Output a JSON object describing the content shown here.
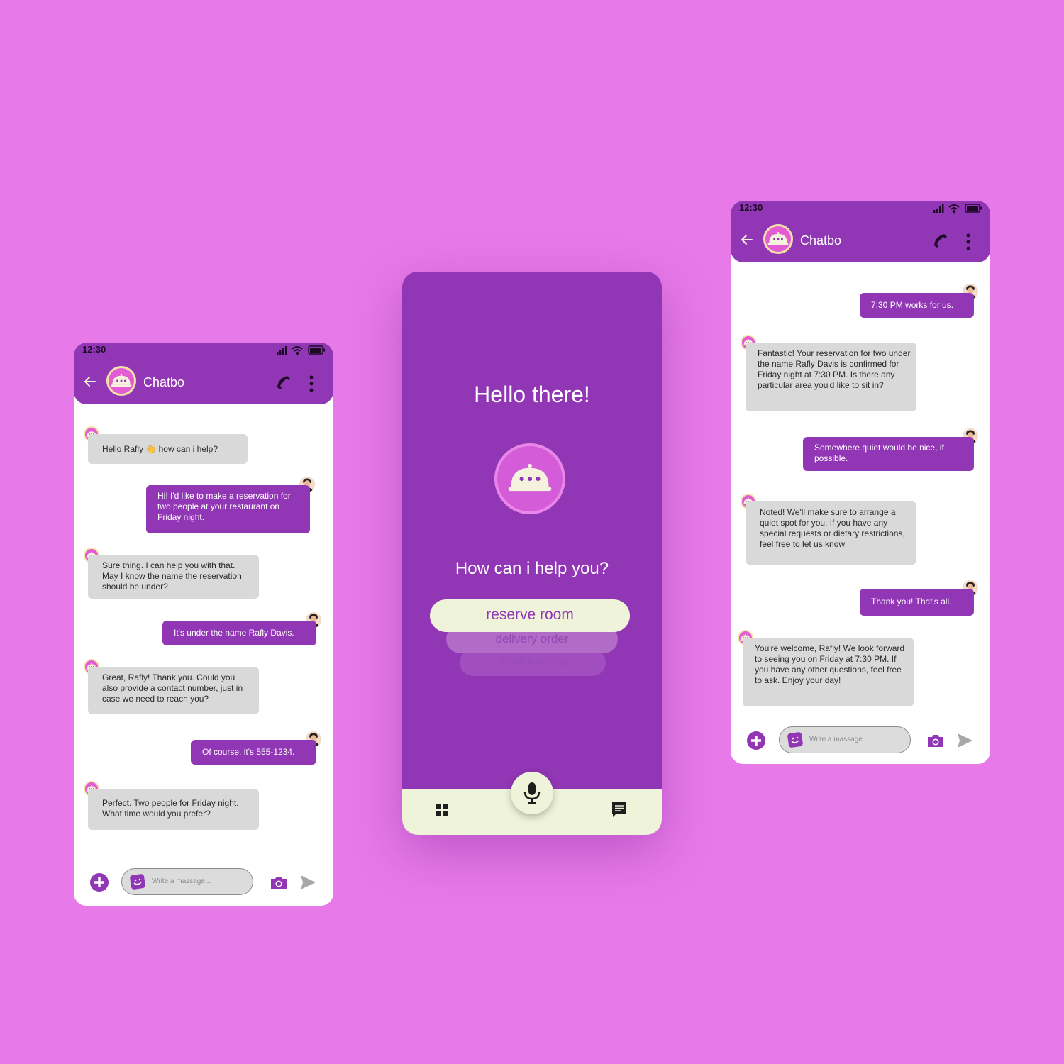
{
  "colors": {
    "background": "#e77ae8",
    "primary": "#9136b4",
    "bubble_bot": "#d9d9d9",
    "cream": "#eef3da",
    "bot_avatar": "#e45cd4"
  },
  "left_phone": {
    "status_time": "12:30",
    "title": "Chatbo",
    "messages": [
      {
        "from": "bot",
        "text": "Hello Rafly 👋 how can i help?"
      },
      {
        "from": "user",
        "text": "Hi! I'd like to make a reservation for two people at your restaurant on Friday night."
      },
      {
        "from": "bot",
        "text": "Sure thing. I can help you with that. May I know the name the reservation should be under?"
      },
      {
        "from": "user",
        "text": "It's under the name Rafly Davis."
      },
      {
        "from": "bot",
        "text": "Great, Rafly! Thank you. Could you also provide a contact number, just in case we need to reach you?"
      },
      {
        "from": "user",
        "text": "Of course, it's 555-1234."
      },
      {
        "from": "bot",
        "text": "Perfect. Two people for Friday night. What time would you prefer?"
      }
    ],
    "input_placeholder": "Write a massage..."
  },
  "center_phone": {
    "greeting": "Hello there!",
    "question": "How can i help you?",
    "options": [
      "reserve room",
      "delivery order",
      "order tracking"
    ]
  },
  "right_phone": {
    "status_time": "12:30",
    "title": "Chatbo",
    "messages": [
      {
        "from": "user",
        "text": "7:30 PM works for us."
      },
      {
        "from": "bot",
        "text": "Fantastic! Your reservation for two under the name Rafly Davis is confirmed for Friday night at 7:30 PM. Is there any particular area you'd like to sit in?"
      },
      {
        "from": "user",
        "text": "Somewhere quiet would be nice, if possible."
      },
      {
        "from": "bot",
        "text": "Noted! We'll make sure to arrange a quiet spot for you. If you have any special requests or dietary restrictions, feel free to let us know"
      },
      {
        "from": "user",
        "text": "Thank you! That's all."
      },
      {
        "from": "bot",
        "text": "You're welcome, Rafly! We look forward to seeing you on Friday at 7:30 PM. If you have any other questions, feel free to ask. Enjoy your day!"
      }
    ],
    "input_placeholder": "Write a massage..."
  },
  "icons": [
    "back-arrow-icon",
    "bot-cloche-icon",
    "phone-icon",
    "more-vert-icon",
    "add-circle-icon",
    "sticker-icon",
    "camera-icon",
    "send-icon",
    "grid-icon",
    "microphone-icon",
    "chat-icon",
    "signal-icon",
    "wifi-icon",
    "battery-icon",
    "user-avatar-icon"
  ]
}
